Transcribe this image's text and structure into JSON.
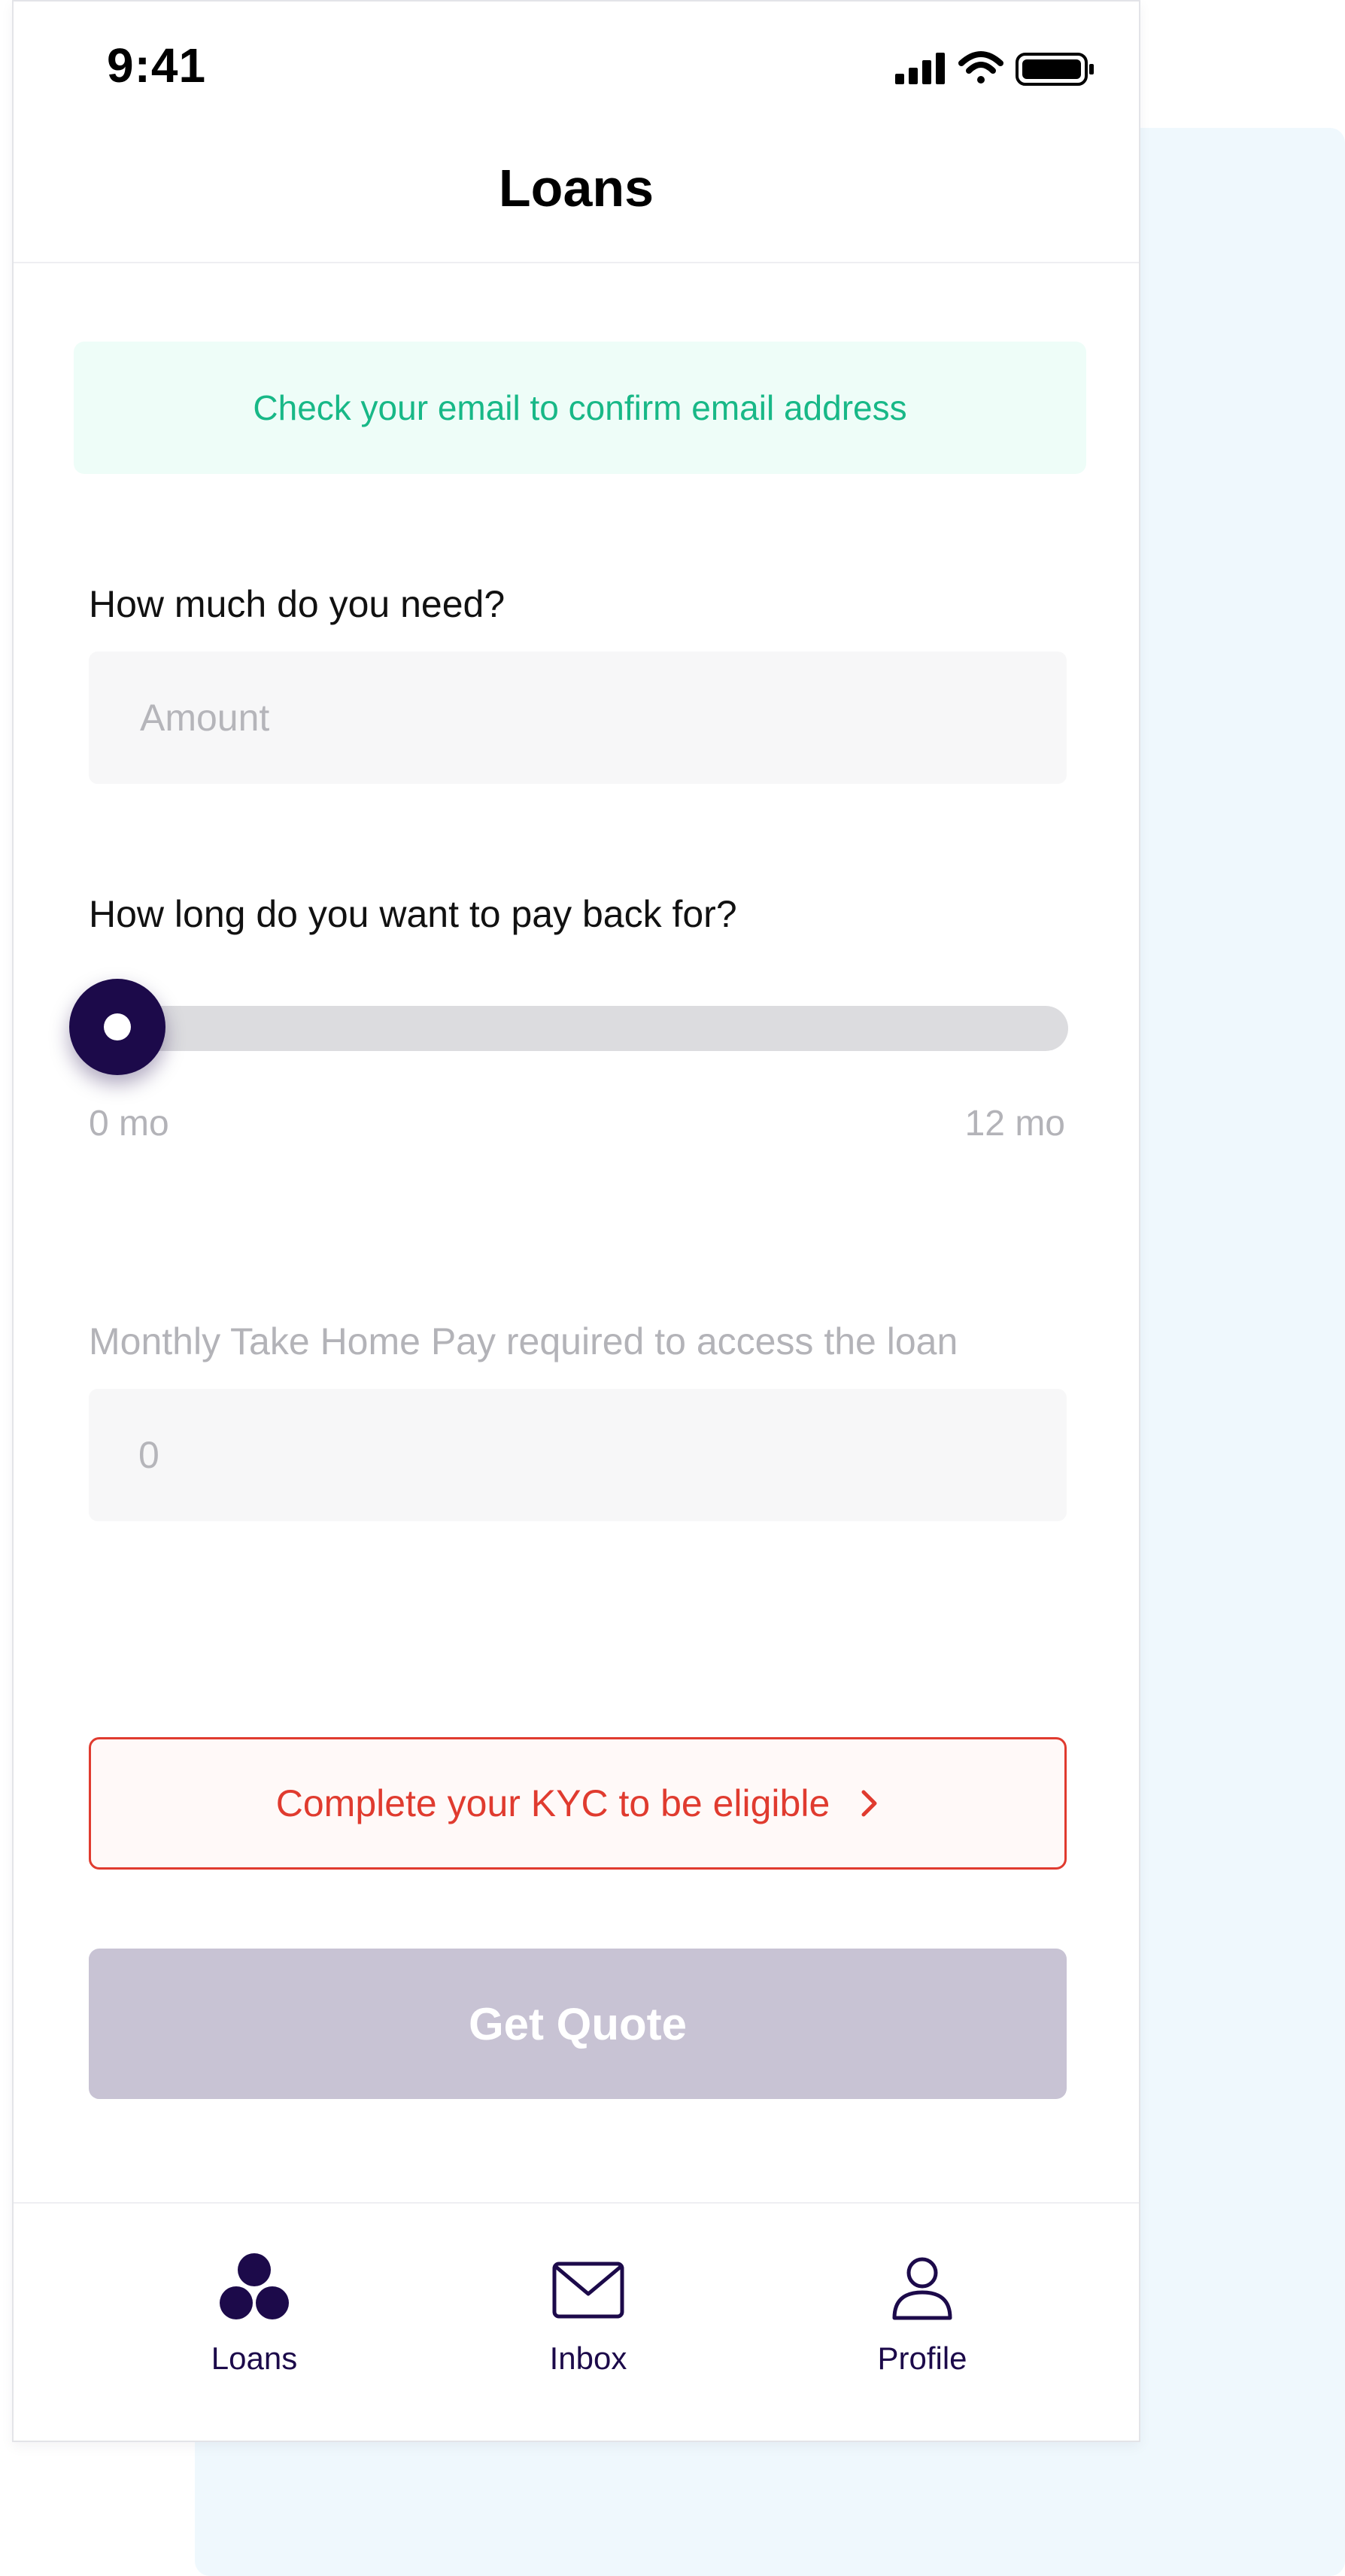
{
  "status_bar": {
    "time": "9:41"
  },
  "header": {
    "title": "Loans"
  },
  "banner": {
    "text": "Check your email to confirm email address"
  },
  "amount": {
    "label": "How much do you need?",
    "placeholder": "Amount",
    "value": ""
  },
  "term": {
    "label": "How long do you want to pay back for?",
    "min_label": "0 mo",
    "max_label": "12 mo",
    "min": 0,
    "max": 12,
    "value": 0
  },
  "take_home": {
    "label": "Monthly Take Home Pay required to access the loan",
    "value": "0"
  },
  "kyc_button": {
    "label": "Complete your KYC to be eligible",
    "icon": "chevron-right-icon"
  },
  "quote_button": {
    "label": "Get Quote",
    "enabled": false
  },
  "tabs": [
    {
      "label": "Loans",
      "icon": "loans-icon",
      "active": true
    },
    {
      "label": "Inbox",
      "icon": "mail-icon",
      "active": false
    },
    {
      "label": "Profile",
      "icon": "person-icon",
      "active": false
    }
  ],
  "colors": {
    "primary": "#1c0a4a",
    "success": "#18b887",
    "danger": "#e03b2f",
    "disabled_button": "#c8c3d4",
    "background_panel": "#eff8fd"
  }
}
